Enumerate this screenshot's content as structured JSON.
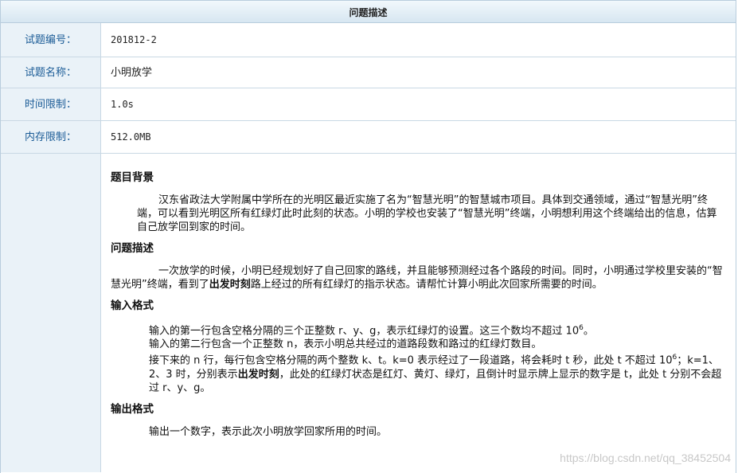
{
  "panel": {
    "title": "问题描述"
  },
  "meta": [
    {
      "label": "试题编号：",
      "value": "201812-2"
    },
    {
      "label": "试题名称：",
      "value": "小明放学"
    },
    {
      "label": "时间限制：",
      "value": "1.0s"
    },
    {
      "label": "内存限制：",
      "value": "512.0MB"
    }
  ],
  "sections": {
    "background": {
      "heading": "题目背景",
      "text": "汉东省政法大学附属中学所在的光明区最近实施了名为“智慧光明”的智慧城市项目。具体到交通领域，通过“智慧光明”终端，可以看到光明区所有红绿灯此时此刻的状态。小明的学校也安装了“智慧光明”终端，小明想利用这个终端给出的信息，估算自己放学回到家的时间。"
    },
    "problem": {
      "heading": "问题描述",
      "text_a": "一次放学的时候，小明已经规划好了自己回家的路线，并且能够预测经过各个路段的时间。同时，小明通过学校里安装的“智慧光明”终端，看到了",
      "emph": "出发时刻",
      "text_b": "路上经过的所有红绿灯的指示状态。请帮忙计算小明此次回家所需要的时间。"
    },
    "input": {
      "heading": "输入格式",
      "line1_a": "输入的第一行包含空格分隔的三个正整数 r、y、g，表示红绿灯的设置。这三个数均不超过 10",
      "line1_exp": "6",
      "line1_b": "。",
      "line2": "输入的第二行包含一个正整数 n，表示小明总共经过的道路段数和路过的红绿灯数目。",
      "line3_a": "接下来的 n 行，每行包含空格分隔的两个整数 k、t。k=0 表示经过了一段道路，将会耗时 t 秒，此处 t 不超过 10",
      "line3_exp": "6",
      "line3_b": "；k=1、2、3 时，分别表示",
      "line3_emph": "出发时刻",
      "line3_c": "，此处的红绿灯状态是红灯、黄灯、绿灯，且倒计时显示牌上显示的数字是 t，此处 t 分别不会超过 r、y、g。"
    },
    "output": {
      "heading": "输出格式",
      "text": "输出一个数字，表示此次小明放学回家所用的时间。"
    }
  },
  "watermark": "https://blog.csdn.net/qq_38452504"
}
